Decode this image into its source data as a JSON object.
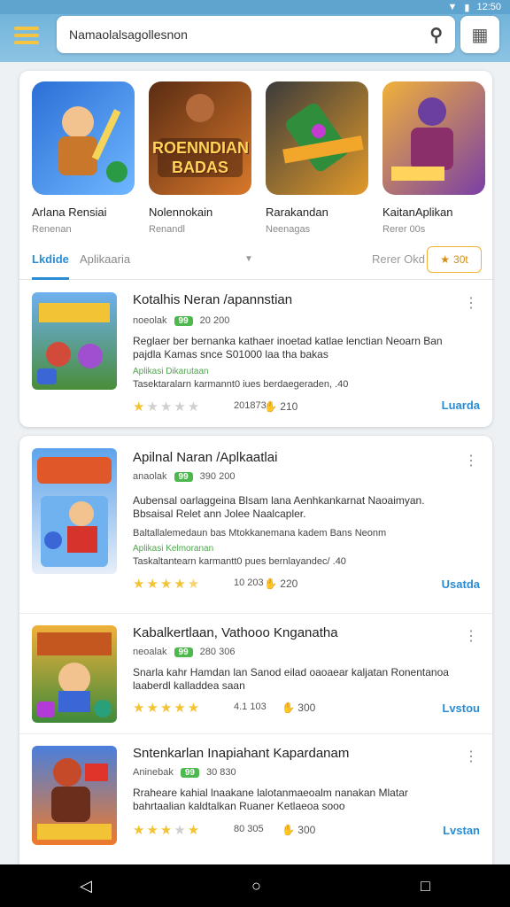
{
  "status": {
    "time": "12:50"
  },
  "search": {
    "query": "Namaolalsagollesnon"
  },
  "featured": [
    {
      "title": "Arlana Rensiai",
      "subtitle": "Renenan",
      "banner": ""
    },
    {
      "title": "Nolennokain",
      "subtitle": "Renandl",
      "banner": "ROENNDIAN BADAS"
    },
    {
      "title": "Rarakandan",
      "subtitle": "Neenagas",
      "banner": ""
    },
    {
      "title": "KaitanAplikan",
      "subtitle": "Rerer 00s",
      "banner": ""
    }
  ],
  "tabs": {
    "active": "Lkdide",
    "second": "Aplikaaria",
    "sort": "Rerer Okd",
    "filter": "30t"
  },
  "items": [
    {
      "title": "Kotalhis Neran /apannstian",
      "dev": "noeolak",
      "badge": "99",
      "size": "20 200",
      "desc": "Reglaer ber bernanka kathaer inoetad katlae lenctian Neoarn Ban pajdla Kamas snce S01000 laa tha bakas",
      "tag": "Aplikasi Dikarutaan",
      "sub": "Tasektaralarn karmannt0 iues berdaegeraden, .40",
      "rating": "201873",
      "likes": "210",
      "action": "Luarda",
      "stars": 1
    },
    {
      "title": "Apilnal Naran /Aplkaatlai",
      "dev": "anaolak",
      "badge": "99",
      "size": "390 200",
      "desc": "Aubensal oarlaggeina Blsam lana Aenhkankarnat Naoaimyan. Bbsaisal Relet ann Jolee Naalcapler.",
      "tag": "Aplikasi Kelmoranan",
      "sub": "Baltallalemedaun bas Mtokkanemana kadem Bans Neonm",
      "sub2": "Taskaltantearn karmantt0 pues bernlayandec/ .40",
      "rating": "10 203",
      "likes": "220",
      "action": "Usatda",
      "stars": 4
    },
    {
      "title": "Kabalkertlaan, Vathooo Knganatha",
      "dev": "neoalak",
      "badge": "99",
      "size": "280 306",
      "desc": "Snarla kahr Hamdan lan Sanod eilad oaoaear kaljatan Ronentanoa laaberdl kalladdea saan",
      "rating": "4.1 103",
      "likes": "300",
      "action": "Lvstou",
      "stars": 5
    },
    {
      "title": "Sntenkarlan Inapiahant Kapardanam",
      "dev": "Aninebak",
      "badge": "99",
      "size": "30 830",
      "desc": "Rraheare kahial lnaakane lalotanmaeoalm nanakan Mlatar bahrtaalian kaldtalkan Ruaner Ketlaeoa sooo",
      "rating": "80 305",
      "likes": "300",
      "action": "Lvstan",
      "stars": 4
    }
  ]
}
